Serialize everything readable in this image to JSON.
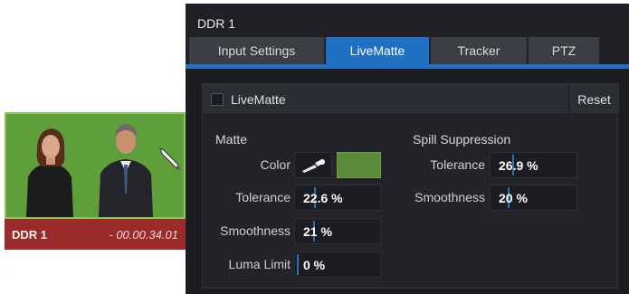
{
  "monitor": {
    "name": "DDR 1",
    "time": "- 00.00.34.01"
  },
  "panel": {
    "title": "DDR 1",
    "tabs": [
      {
        "label": "Input Settings",
        "active": false
      },
      {
        "label": "LiveMatte",
        "active": true
      },
      {
        "label": "Tracker",
        "active": false
      },
      {
        "label": "PTZ",
        "active": false
      }
    ]
  },
  "livematte": {
    "enable_label": "LiveMatte",
    "enabled": false,
    "reset_label": "Reset"
  },
  "matte": {
    "title": "Matte",
    "color_label": "Color",
    "color_value": "#5a8a3a",
    "tolerance_label": "Tolerance",
    "tolerance_value": "22.6 %",
    "smoothness_label": "Smoothness",
    "smoothness_value": "21 %",
    "luma_label": "Luma Limit",
    "luma_value": "0 %"
  },
  "spill": {
    "title": "Spill Suppression",
    "tolerance_label": "Tolerance",
    "tolerance_value": "26.9 %",
    "smoothness_label": "Smoothness",
    "smoothness_value": "20 %"
  },
  "colors": {
    "accent": "#1f6fc2",
    "monitor_bar": "#9b2a2a",
    "green_screen": "#5f9f3b"
  },
  "icons": {
    "picker": "eyedropper-icon",
    "cursor": "pen-cursor-icon"
  }
}
